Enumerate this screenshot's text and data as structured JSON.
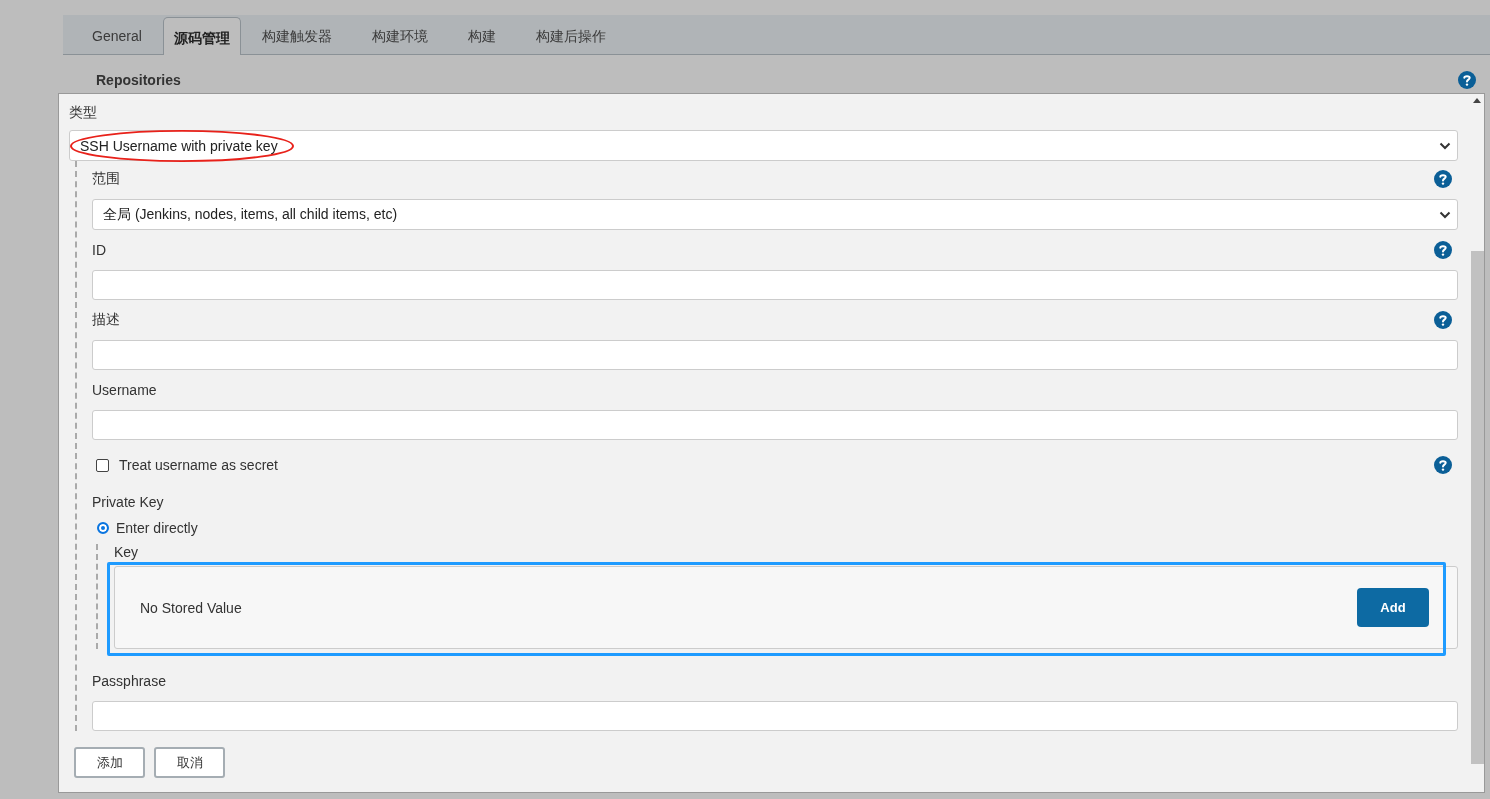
{
  "tabs": [
    {
      "label": "General",
      "selected": false
    },
    {
      "label": "源码管理",
      "selected": true
    },
    {
      "label": "构建触发器",
      "selected": false
    },
    {
      "label": "构建环境",
      "selected": false
    },
    {
      "label": "构建",
      "selected": false
    },
    {
      "label": "构建后操作",
      "selected": false
    }
  ],
  "background": {
    "section_label": "Repositories"
  },
  "dialog": {
    "type_field": {
      "label": "类型",
      "value": "SSH Username with private key",
      "circled": true
    },
    "fields": [
      {
        "kind": "select",
        "label": "范围",
        "value": "全局 (Jenkins, nodes, items, all child items, etc)",
        "help": true
      },
      {
        "kind": "text",
        "label": "ID",
        "help": true
      },
      {
        "kind": "text",
        "label": "描述",
        "help": true
      },
      {
        "kind": "text",
        "label": "Username",
        "help": false
      },
      {
        "kind": "checkbox",
        "label": "Treat username as secret",
        "checked": false,
        "help": true
      },
      {
        "kind": "private_key",
        "label": "Private Key",
        "option": {
          "label": "Enter directly",
          "selected": true
        },
        "key_label": "Key",
        "stored_value": "No Stored Value",
        "button": "Add",
        "highlighted": true
      },
      {
        "kind": "text",
        "label": "Passphrase",
        "help": false
      }
    ],
    "buttons": [
      "添加",
      "取消"
    ]
  }
}
